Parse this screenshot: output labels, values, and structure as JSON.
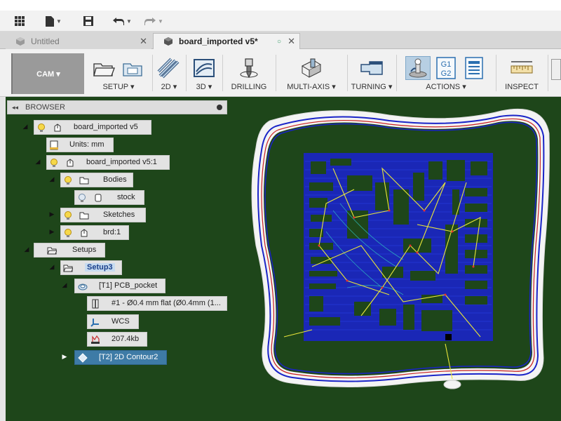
{
  "tabs": {
    "untitled": "Untitled",
    "board": "board_imported v5*"
  },
  "ribbon": {
    "workspace": "CAM ▾",
    "groups": {
      "setup": "SETUP ▾",
      "two_d": "2D ▾",
      "three_d": "3D ▾",
      "drilling": "DRILLING",
      "multi_axis": "MULTI-AXIS ▾",
      "turning": "TURNING ▾",
      "actions": "ACTIONS ▾",
      "inspect": "INSPECT"
    },
    "g1g2": [
      "G1",
      "G2"
    ]
  },
  "browser": {
    "title": "BROWSER",
    "nodes": {
      "root": "board_imported v5",
      "units": "Units: mm",
      "component": "board_imported v5:1",
      "bodies": "Bodies",
      "stock": "stock",
      "sketches": "Sketches",
      "brd": "brd:1",
      "setups": "Setups",
      "setup3": "Setup3",
      "op1": "[T1] PCB_pocket",
      "tool": "#1 - Ø0.4 mm flat (Ø0.4mm (1...",
      "wcs": "WCS",
      "size": "207.4kb",
      "op2": "[T2] 2D Contour2"
    }
  },
  "colors": {
    "canvas_bg": "#1e461a",
    "toolpath_blue": "#1a24c8",
    "rapid_yellow": "#e8e53a",
    "contour_red": "#c82020",
    "selected_node": "#3e7ba6"
  }
}
